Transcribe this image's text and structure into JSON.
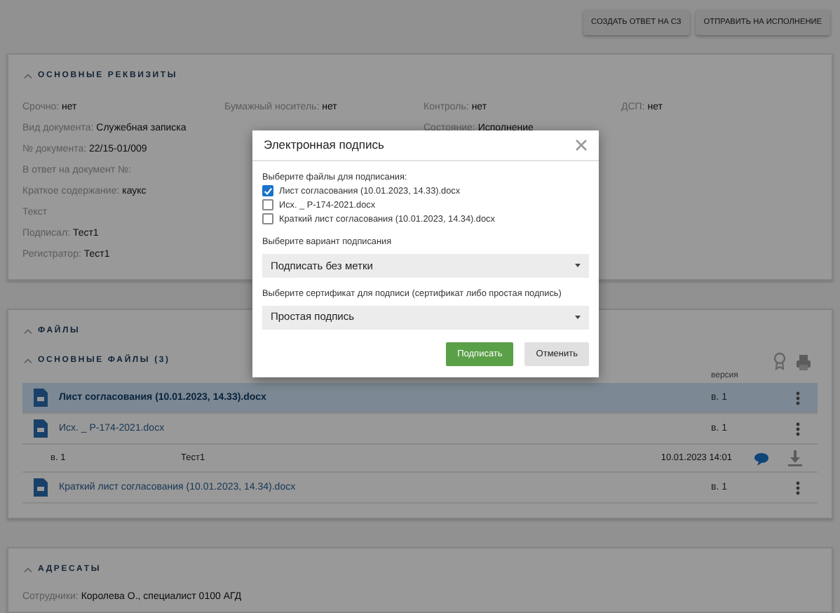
{
  "header_buttons": [
    {
      "label": "СОЗДАТЬ ОТВЕТ НА СЗ"
    },
    {
      "label": "ОТПРАВИТЬ НА ИСПОЛНЕНИЕ"
    }
  ],
  "details": {
    "title": "ОСНОВНЫЕ РЕКВИЗИТЫ",
    "expanded": true,
    "rows": [
      [
        {
          "label": "Срочно:",
          "value": "нет"
        },
        {
          "label": "Бумажный носитель:",
          "value": "нет"
        },
        {
          "label": "Контроль:",
          "value": "нет"
        },
        {
          "label": "ДСП:",
          "value": "нет"
        }
      ],
      [
        {
          "label": "Вид документа:",
          "value": "Служебная записка"
        },
        null,
        {
          "label": "Состояние:",
          "value": "Исполнение"
        },
        null
      ],
      [
        {
          "label": "№ документа:",
          "value": "22/15-01/009"
        }
      ],
      [
        {
          "label": "В ответ на документ №:"
        }
      ],
      [
        {
          "label": "Краткое содержание:",
          "value": "каукс"
        }
      ],
      [
        {
          "label": "Текст"
        }
      ],
      [
        {
          "label": "Подписал:",
          "value": "Тест1"
        }
      ],
      [
        {
          "label": "Регистратор:",
          "value": "Тест1"
        }
      ]
    ]
  },
  "files": {
    "title": "ФАЙЛЫ",
    "expanded": true,
    "group": {
      "title": "ОСНОВНЫЕ ФАЙЛЫ (3)",
      "expanded": true,
      "version_header": "версия",
      "files": [
        {
          "name": "Лист согласования (10.01.2023, 14.33).docx",
          "version": "в. 1",
          "selected": true
        },
        {
          "name": "Исх. _ Р-174-2021.docx",
          "version": "в. 1",
          "selected": false,
          "versions": [
            {
              "version": "в. 1",
              "author": "Тест1",
              "date": "10.01.2023 14:01"
            }
          ]
        },
        {
          "name": "Краткий лист согласования (10.01.2023, 14.34).docx",
          "version": "в. 1",
          "selected": false
        }
      ]
    }
  },
  "recipients": {
    "title": "АДРЕСАТЫ",
    "expanded": true,
    "fields": [
      {
        "label": "Сотрудники:",
        "value": "Королева О., специалист 0100 АГД"
      }
    ]
  },
  "dialog": {
    "title": "Электронная подпись",
    "files_label": "Выберите файлы для подписания:",
    "files": [
      {
        "label": "Лист согласования (10.01.2023, 14.33).docx",
        "checked": true
      },
      {
        "label": "Исх. _ Р-174-2021.docx",
        "checked": false
      },
      {
        "label": "Краткий лист согласования (10.01.2023, 14.34).docx",
        "checked": false
      }
    ],
    "variant": {
      "label": "Выберите вариант подписания",
      "value": "Подписать без метки"
    },
    "certificate": {
      "label": "Выберите сертификат для подписи (сертификат либо простая подпись)",
      "value": "Простая подпись"
    },
    "buttons": [
      {
        "label": "Подписать",
        "kind": "primary"
      },
      {
        "label": "Отменить",
        "kind": "secondary"
      }
    ]
  }
}
